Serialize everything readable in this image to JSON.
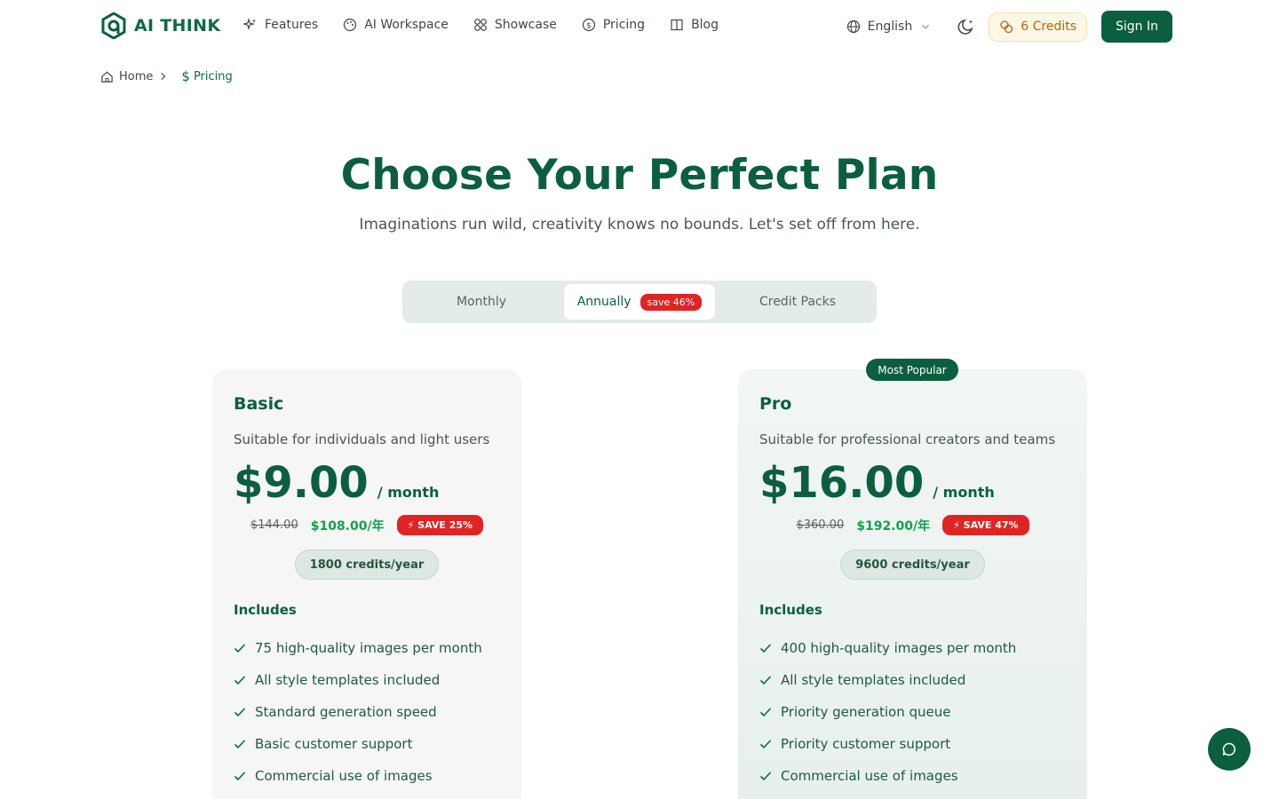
{
  "brand": {
    "name": "AI THINK"
  },
  "nav": {
    "links": [
      {
        "label": "Features",
        "icon": "sparkles-icon"
      },
      {
        "label": "AI Workspace",
        "icon": "palette-icon"
      },
      {
        "label": "Showcase",
        "icon": "grid-icon"
      },
      {
        "label": "Pricing",
        "icon": "dollar-circle-icon"
      },
      {
        "label": "Blog",
        "icon": "book-icon"
      }
    ],
    "language": "English",
    "credits": "6 Credits",
    "signin": "Sign In"
  },
  "breadcrumb": {
    "home": "Home",
    "current": "Pricing"
  },
  "hero": {
    "title": "Choose Your Perfect Plan",
    "subtitle": "Imaginations run wild, creativity knows no bounds. Let's set off from here."
  },
  "billing_tabs": {
    "monthly": "Monthly",
    "annually": "Annually",
    "annual_badge": "save 46%",
    "packs": "Credit Packs",
    "selected": "Annually"
  },
  "plans": [
    {
      "name": "Basic",
      "description": "Suitable for individuals and light users",
      "price": "$9.00",
      "period": "/ month",
      "old_price": "$144.00",
      "new_price": "$108.00/年",
      "save": "⚡ SAVE 25%",
      "credits": "1800 credits/year",
      "includes": "Includes",
      "features": [
        "75 high-quality images per month",
        "All style templates included",
        "Standard generation speed",
        "Basic customer support",
        "Commercial use of images"
      ]
    },
    {
      "name": "Pro",
      "badge": "Most Popular",
      "description": "Suitable for professional creators and teams",
      "price": "$16.00",
      "period": "/ month",
      "old_price": "$360.00",
      "new_price": "$192.00/年",
      "save": "⚡ SAVE 47%",
      "credits": "9600 credits/year",
      "includes": "Includes",
      "features": [
        "400 high-quality images per month",
        "All style templates included",
        "Priority generation queue",
        "Priority customer support",
        "Commercial use of images"
      ]
    }
  ],
  "colors": {
    "primary": "#0b5f3f",
    "accent_green": "#14a04d",
    "badge_red": "#e02424",
    "credits_amber": "#b6650a"
  }
}
